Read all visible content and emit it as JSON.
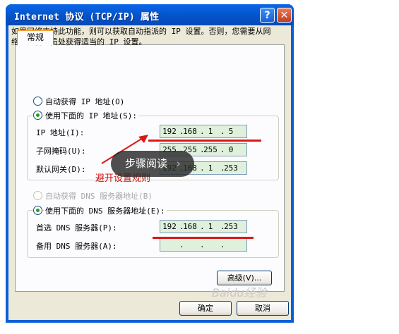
{
  "window": {
    "title": "Internet 协议 (TCP/IP) 属性",
    "help_glyph": "?",
    "close_glyph": "✕"
  },
  "tab": {
    "label": "常规"
  },
  "description": "如果网络支持此功能，则可以获取自动指派的 IP 设置。否则，您需要从网络系统管理员处获得适当的 IP 设置。",
  "ip_section": {
    "auto_label": "自动获得 IP 地址(O)",
    "auto_selected": false,
    "manual_label": "使用下面的 IP 地址(S):",
    "manual_selected": true,
    "ip_address": {
      "label": "IP 地址(I):",
      "octets": [
        "192",
        "168",
        "1",
        "5"
      ]
    },
    "subnet_mask": {
      "label": "子网掩码(U):",
      "octets": [
        "255",
        "255",
        "255",
        "0"
      ]
    },
    "default_gateway": {
      "label": "默认网关(D):",
      "octets": [
        "192",
        "168",
        "1",
        "253"
      ]
    }
  },
  "dns_section": {
    "auto_label": "自动获得 DNS 服务器地址(B)",
    "auto_selected": false,
    "auto_disabled": true,
    "manual_label": "使用下面的 DNS 服务器地址(E):",
    "manual_selected": true,
    "preferred": {
      "label": "首选 DNS 服务器(P):",
      "octets": [
        "192",
        "168",
        "1",
        "253"
      ]
    },
    "alternate": {
      "label": "备用 DNS 服务器(A):",
      "octets": [
        "",
        "",
        "",
        ""
      ]
    }
  },
  "buttons": {
    "advanced": "高级(V)...",
    "ok": "确定",
    "cancel": "取消"
  },
  "annotation": {
    "text": "避开设置规则"
  },
  "overlay": {
    "text": "步骤阅读",
    "chevron": "›"
  },
  "watermark": {
    "text": "Baidu经验"
  },
  "colors": {
    "annotation_red": "#d81818",
    "titlebar_blue": "#0254c9",
    "field_green": "#dff0dc"
  }
}
